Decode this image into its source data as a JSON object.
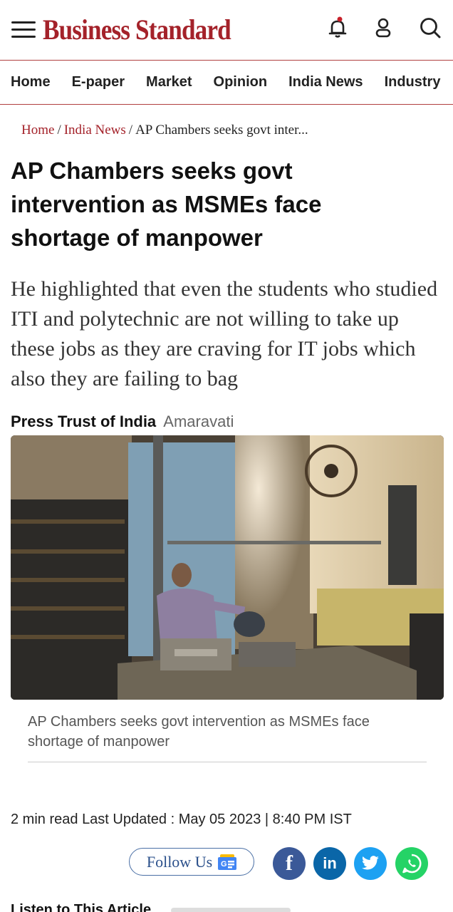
{
  "header": {
    "logo": "Business Standard",
    "brand_color": "#a4222a",
    "icons": [
      "menu-icon",
      "notification-bell-icon",
      "user-icon",
      "search-icon"
    ]
  },
  "nav": {
    "items": [
      "Home",
      "E-paper",
      "Market",
      "Opinion",
      "India News",
      "Industry"
    ]
  },
  "breadcrumb": {
    "items": [
      "Home",
      "India News"
    ],
    "separator": "/",
    "current": "AP Chambers seeks govt inter..."
  },
  "article": {
    "title": "AP Chambers seeks govt intervention as MSMEs face shortage of manpower",
    "summary": "He highlighted that even the students who studied ITI and polytechnic are not willing to take up these jobs as they are craving for IT jobs which also they are failing to bag",
    "author": "Press Trust of India",
    "location": "Amaravati",
    "caption": "AP Chambers seeks govt intervention as MSMEs face shortage of manpower",
    "read_time": "2 min read",
    "updated": "Last Updated : May 05 2023 | 8:40 PM IST"
  },
  "share": {
    "follow_label": "Follow Us",
    "icons": [
      "google-news-icon",
      "facebook-icon",
      "linkedin-icon",
      "twitter-icon",
      "whatsapp-icon"
    ],
    "facebook_glyph": "f",
    "linkedin_glyph": "in",
    "colors": {
      "facebook": "#3b5998",
      "linkedin": "#0a66a8",
      "twitter": "#1da1f2",
      "whatsapp": "#25d366"
    }
  },
  "listen": {
    "label": "Listen to This Article"
  }
}
